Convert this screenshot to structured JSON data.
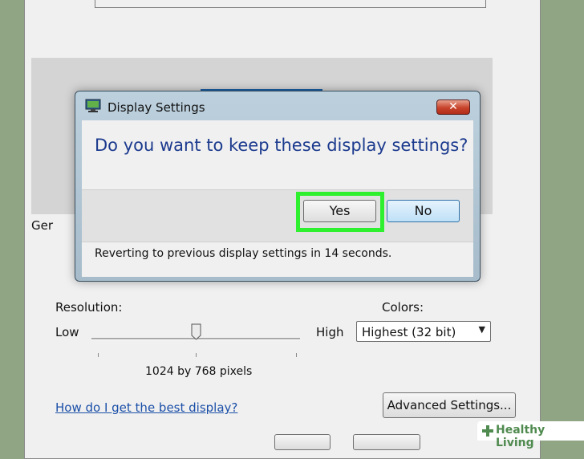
{
  "dialog": {
    "title": "Display Settings",
    "close_label": "✕",
    "question": "Do you want to keep these display settings?",
    "yes_label": "Yes",
    "no_label": "No",
    "status": "Reverting to previous display settings in 14 seconds."
  },
  "settings": {
    "general_label_partial": "Ger",
    "resolution_label": "Resolution:",
    "low_label": "Low",
    "high_label": "High",
    "resolution_level": 0.5,
    "resolution_value": "1024 by 768 pixels",
    "colors_label": "Colors:",
    "colors_value": "Highest (32 bit)",
    "help_link": "How do I get the best display?",
    "advanced_label": "Advanced Settings..."
  },
  "watermark": {
    "text": "Healthy Living"
  },
  "colors": {
    "highlight": "#2ef02e",
    "link": "#1b4fa8",
    "question_text": "#1b3a8e"
  }
}
